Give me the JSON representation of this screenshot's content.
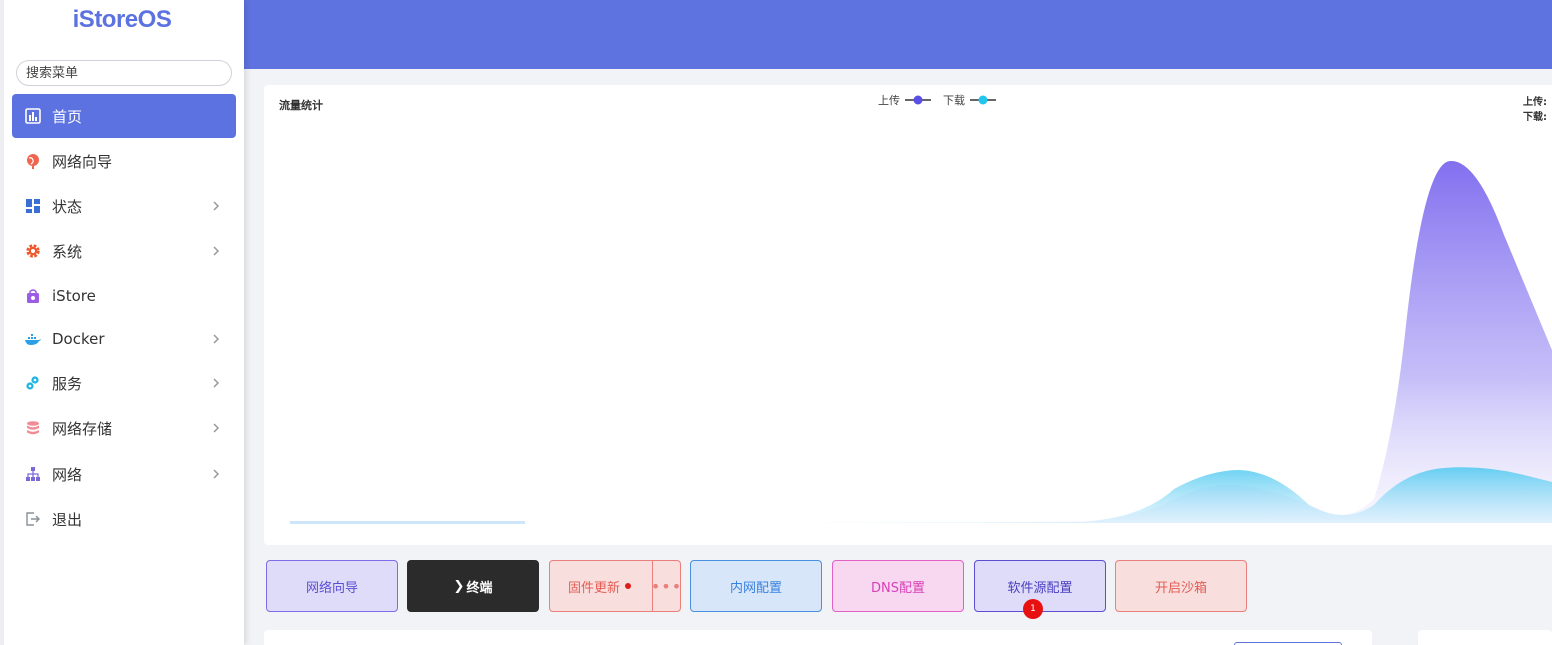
{
  "sidebar": {
    "logo": "iStoreOS",
    "search_placeholder": "搜索菜单",
    "items": [
      {
        "label": "首页",
        "active": true
      },
      {
        "label": "网络向导"
      },
      {
        "label": "状态"
      },
      {
        "label": "系统"
      },
      {
        "label": "iStore"
      },
      {
        "label": "Docker"
      },
      {
        "label": "服务"
      },
      {
        "label": "网络存储"
      },
      {
        "label": "网络"
      },
      {
        "label": "退出"
      }
    ]
  },
  "traffic": {
    "title": "流量统计",
    "legend": [
      {
        "name": "上传",
        "color": "#6a5ae6"
      },
      {
        "name": "下载",
        "color": "#22c5ee"
      }
    ],
    "readout": {
      "upload": "上传:",
      "download": "下载:"
    }
  },
  "actions": {
    "network_wizard": "网络向导",
    "terminal": "终端",
    "terminal_prefix": "❯",
    "firmware_update": "固件更新",
    "firmware_more": "•••",
    "lan_config": "内网配置",
    "dns_config": "DNS配置",
    "software_source": "软件源配置",
    "software_source_badge": "1",
    "sandbox": "开启沙箱"
  },
  "colors": {
    "accent": "#5e73e0",
    "upload": "#6a5ae6",
    "download": "#22c5ee"
  }
}
